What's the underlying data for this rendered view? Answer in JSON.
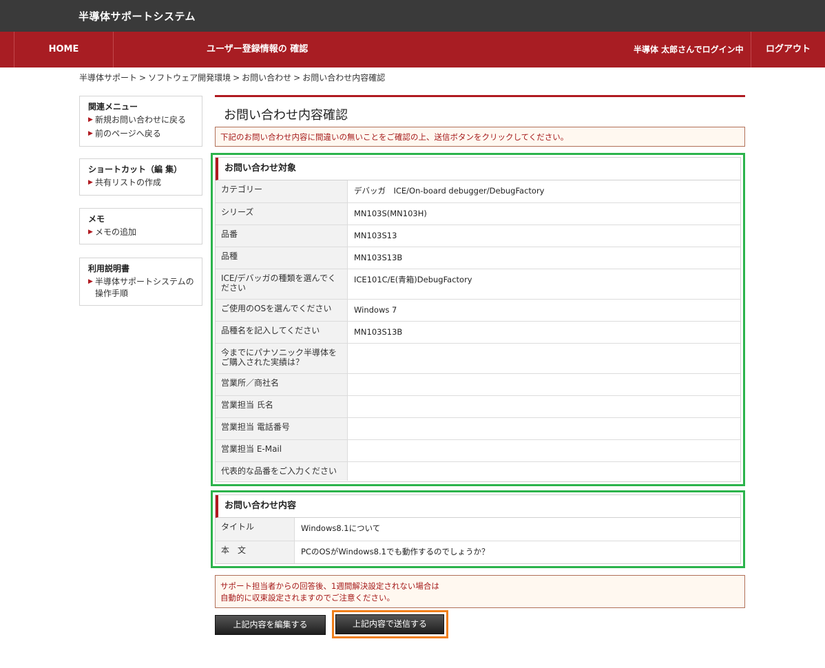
{
  "header": {
    "app_title": "半導体サポートシステム"
  },
  "nav": {
    "home": "HOME",
    "page_heading": "ユーザー登録情報の 確認",
    "login_status": "半導体 太郎さんでログイン中",
    "logout": "ログアウト"
  },
  "breadcrumb": [
    "半導体サポート",
    "ソフトウェア開発環境",
    "お問い合わせ",
    "お問い合わせ内容確認"
  ],
  "breadcrumb_sep": ">",
  "sidebar": {
    "related": {
      "title": "関連メニュー",
      "links": [
        "新規お問い合わせに戻る",
        "前のページへ戻る"
      ]
    },
    "shortcut": {
      "title": "ショートカット（編 集）",
      "links": [
        "共有リストの作成"
      ]
    },
    "memo": {
      "title": "メモ",
      "links": [
        "メモの追加"
      ]
    },
    "manual": {
      "title": "利用説明書",
      "links": [
        "半導体サポートシステムの操作手順"
      ]
    }
  },
  "main": {
    "title": "お問い合わせ内容確認",
    "notice_top": "下記のお問い合わせ内容に間違いの無いことをご確認の上、送信ボタンをクリックしてください。",
    "target_section": {
      "heading": "お問い合わせ対象",
      "rows": [
        {
          "label": "カテゴリー",
          "value": "デバッガ　ICE/On-board debugger/DebugFactory"
        },
        {
          "label": "シリーズ",
          "value": "MN103S(MN103H)"
        },
        {
          "label": "品番",
          "value": "MN103S13"
        },
        {
          "label": "品種",
          "value": "MN103S13B"
        },
        {
          "label": "ICE/デバッガの種類を選んでください",
          "value": "ICE101C/E(青箱)DebugFactory"
        },
        {
          "label": "ご使用のOSを選んでください",
          "value": "Windows 7"
        },
        {
          "label": "品種名を記入してください",
          "value": "MN103S13B"
        },
        {
          "label": "今までにパナソニック半導体をご購入された実績は？",
          "value": ""
        },
        {
          "label": "営業所／商社名",
          "value": ""
        },
        {
          "label": "営業担当 氏名",
          "value": ""
        },
        {
          "label": "営業担当 電話番号",
          "value": ""
        },
        {
          "label": "営業担当 E-Mail",
          "value": ""
        },
        {
          "label": "代表的な品番をご入力ください",
          "value": ""
        }
      ]
    },
    "content_section": {
      "heading": "お問い合わせ内容",
      "rows": [
        {
          "label": "タイトル",
          "value": "Windows8.1について"
        },
        {
          "label": "本　文",
          "value": "PCのOSがWindows8.1でも動作するのでしょうか？"
        }
      ]
    },
    "notice_bottom_line1": "サポート担当者からの回答後、1週間解決設定されない場合は",
    "notice_bottom_line2": "自動的に収束設定されますのでご注意ください。",
    "edit_button": "上記内容を編集する",
    "send_button": "上記内容で送信する"
  }
}
